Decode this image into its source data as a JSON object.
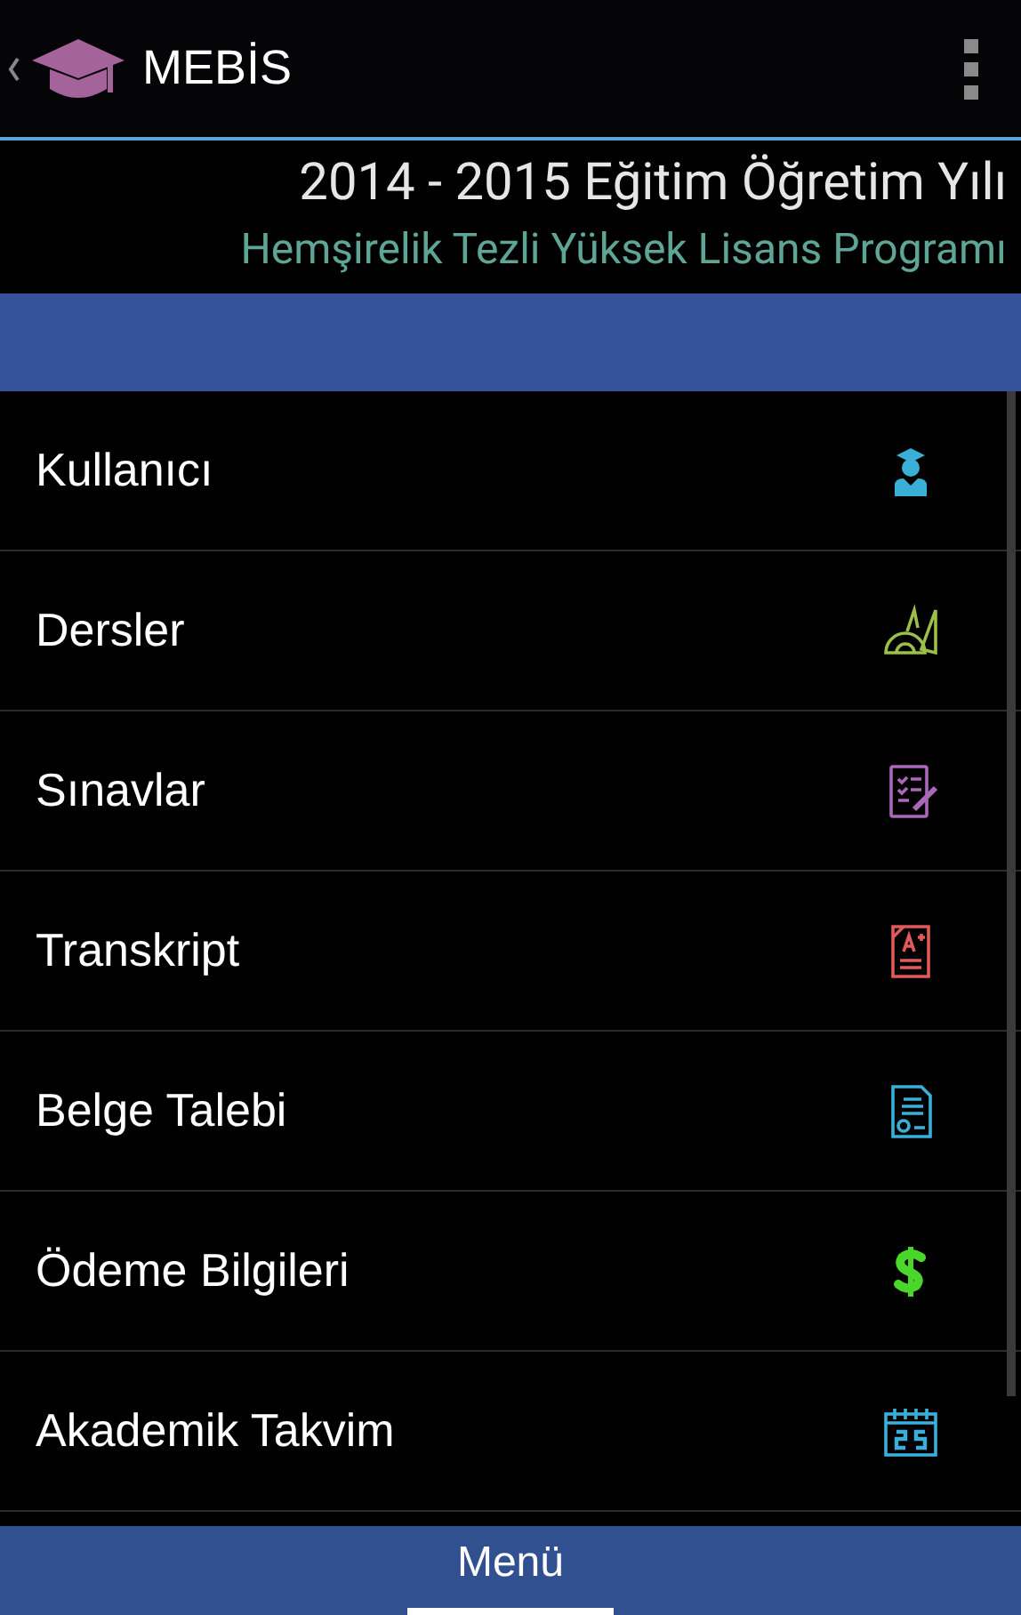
{
  "action_bar": {
    "title": "MEBİS"
  },
  "header": {
    "year": "2014 - 2015 Eğitim Öğretim Yılı",
    "program": "Hemşirelik Tezli Yüksek Lisans Programı"
  },
  "menu_items": [
    {
      "label": "Kullanıcı"
    },
    {
      "label": "Dersler"
    },
    {
      "label": "Sınavlar"
    },
    {
      "label": "Transkript"
    },
    {
      "label": "Belge Talebi"
    },
    {
      "label": "Ödeme Bilgileri"
    },
    {
      "label": "Akademik Takvim"
    }
  ],
  "tabs": [
    {
      "label": "Menü",
      "selected": true
    }
  ]
}
